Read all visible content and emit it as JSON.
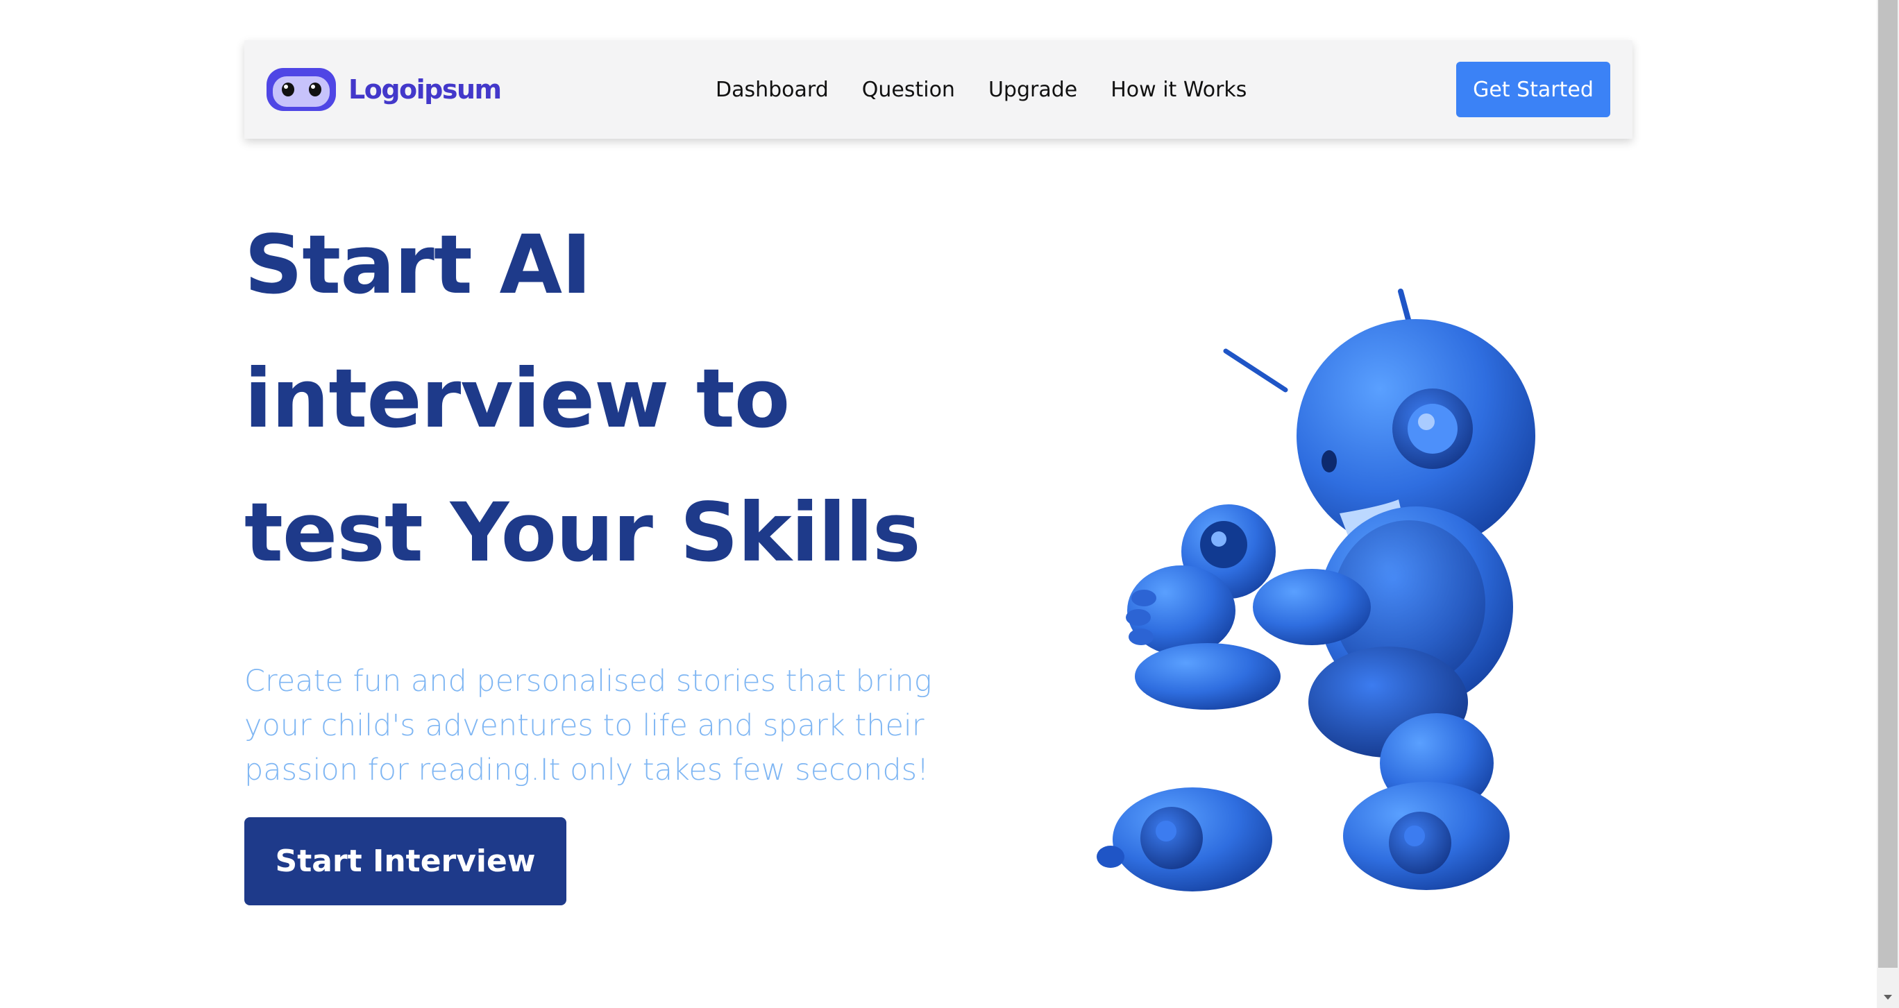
{
  "navbar": {
    "logo_text": "Logoipsum",
    "logo_icon": "robot-eyes-logo",
    "links": [
      "Dashboard",
      "Question",
      "Upgrade",
      "How it Works"
    ],
    "cta_label": "Get Started"
  },
  "hero": {
    "title_lines": [
      "Start AI",
      "interview to",
      "test Your Skills"
    ],
    "description_lines": [
      "Create fun and personalised stories that bring",
      "your child's adventures to life and spark their",
      "passion for reading.It only takes few seconds!"
    ],
    "button_label": "Start Interview",
    "image": "blue-robot-illustration"
  },
  "colors": {
    "brand": "#4338ca",
    "heading": "#1e3a8a",
    "accent": "#3b82f6",
    "description": "#7fb6f3",
    "navbar_bg": "#f4f4f5"
  }
}
